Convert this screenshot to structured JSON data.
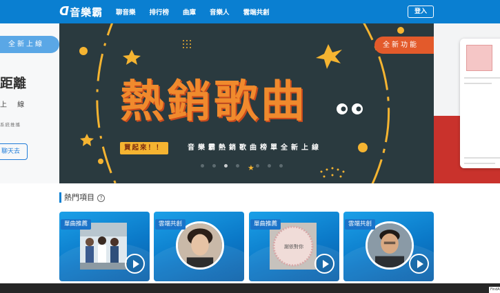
{
  "header": {
    "logo_mark": "ᗡ",
    "logo_text": "音樂霸",
    "nav": [
      "聊音樂",
      "排行榜",
      "曲庫",
      "音樂人",
      "雲端共創"
    ],
    "login": "登入"
  },
  "left_slide": {
    "pill": "全新上線",
    "title": "距離",
    "subtitle": "上 線",
    "small": "系統推播",
    "button": "聊天去"
  },
  "banner": {
    "pill": "全新功能",
    "title": "熱銷歌曲",
    "badge": "買起來！！",
    "subline": "音樂霸熱銷歌曲榜單全新上線"
  },
  "section": {
    "title": "熱門項目",
    "help_icon": "?"
  },
  "cards": [
    {
      "tag": "單曲推薦"
    },
    {
      "tag": "雲端共創"
    },
    {
      "tag": "單曲推薦",
      "photo_text": "謝依對你"
    },
    {
      "tag": "雲端共創"
    }
  ],
  "footer": {
    "tag": "FindA"
  },
  "colors": {
    "header_blue": "#0a7fd1",
    "banner_dark": "#2a3a3f",
    "banner_orange": "#f08a2d",
    "accent_red": "#e35a2b"
  }
}
